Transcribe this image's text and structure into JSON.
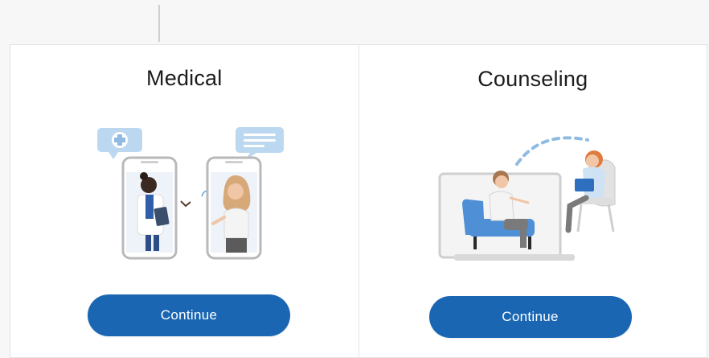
{
  "colors": {
    "accent": "#1a66b3",
    "page_bg": "#f7f7f7",
    "card_bg": "#ffffff",
    "illustration_blue": "#4f8fd6",
    "bubble_blue": "#bcd8f0"
  },
  "cards": [
    {
      "title": "Medical",
      "button_label": "Continue",
      "icon": "video-call-doctor-illustration"
    },
    {
      "title": "Counseling",
      "button_label": "Continue",
      "icon": "counseling-session-illustration"
    }
  ]
}
